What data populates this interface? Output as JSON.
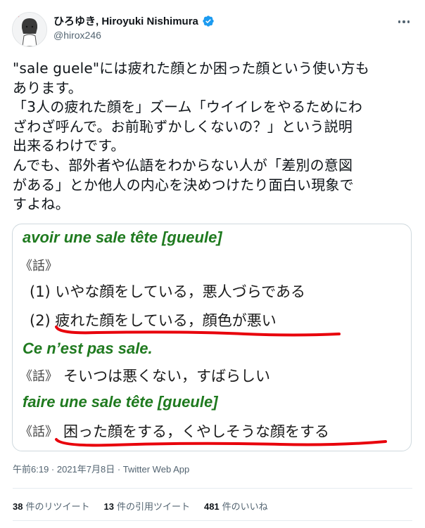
{
  "author": {
    "display_name": "ひろゆき, Hiroyuki Nishimura",
    "handle": "@hirox246"
  },
  "tweet": {
    "text": "\"sale guele\"には疲れた顔とか困った顔という使い方も\nあります。\n「3人の疲れた顔を」ズーム「ウイイレをやるためにわ\nざわざ呼んで。お前恥ずかしくないの？」という説明\n出来るわけです。\nんでも、部外者や仏語をわからない人が「差別の意図\nがある」とか他人の内心を決めつけたり面白い現象で\nすよね。"
  },
  "media": {
    "line1_fr": "avoir une sale tête [gueule]",
    "line2_tag": "《話》",
    "line3": "(1)  いやな顔をしている，悪人づらである",
    "line4": "(2)  疲れた顔をしている，顔色が悪い",
    "line5_fr": "Ce n’est pas sale.",
    "line6_tag": "《話》",
    "line6_text": "そいつは悪くない，すばらしい",
    "line7_fr": "faire une sale tête [gueule]",
    "line8_tag": "《話》",
    "line8_text": "困った顔をする，くやしそうな顔をする",
    "colors": {
      "french": "#1f7a1f",
      "underline": "#e8000b"
    }
  },
  "meta": {
    "timestamp": "午前6:19 · 2021年7月8日 · Twitter Web App"
  },
  "stats": {
    "retweets_count": "38",
    "retweets_label": "件のリツイート",
    "quotes_count": "13",
    "quotes_label": "件の引用ツイート",
    "likes_count": "481",
    "likes_label": "件のいいね"
  },
  "icons": [
    "avatar",
    "verified-badge-icon",
    "more-options-icon"
  ]
}
